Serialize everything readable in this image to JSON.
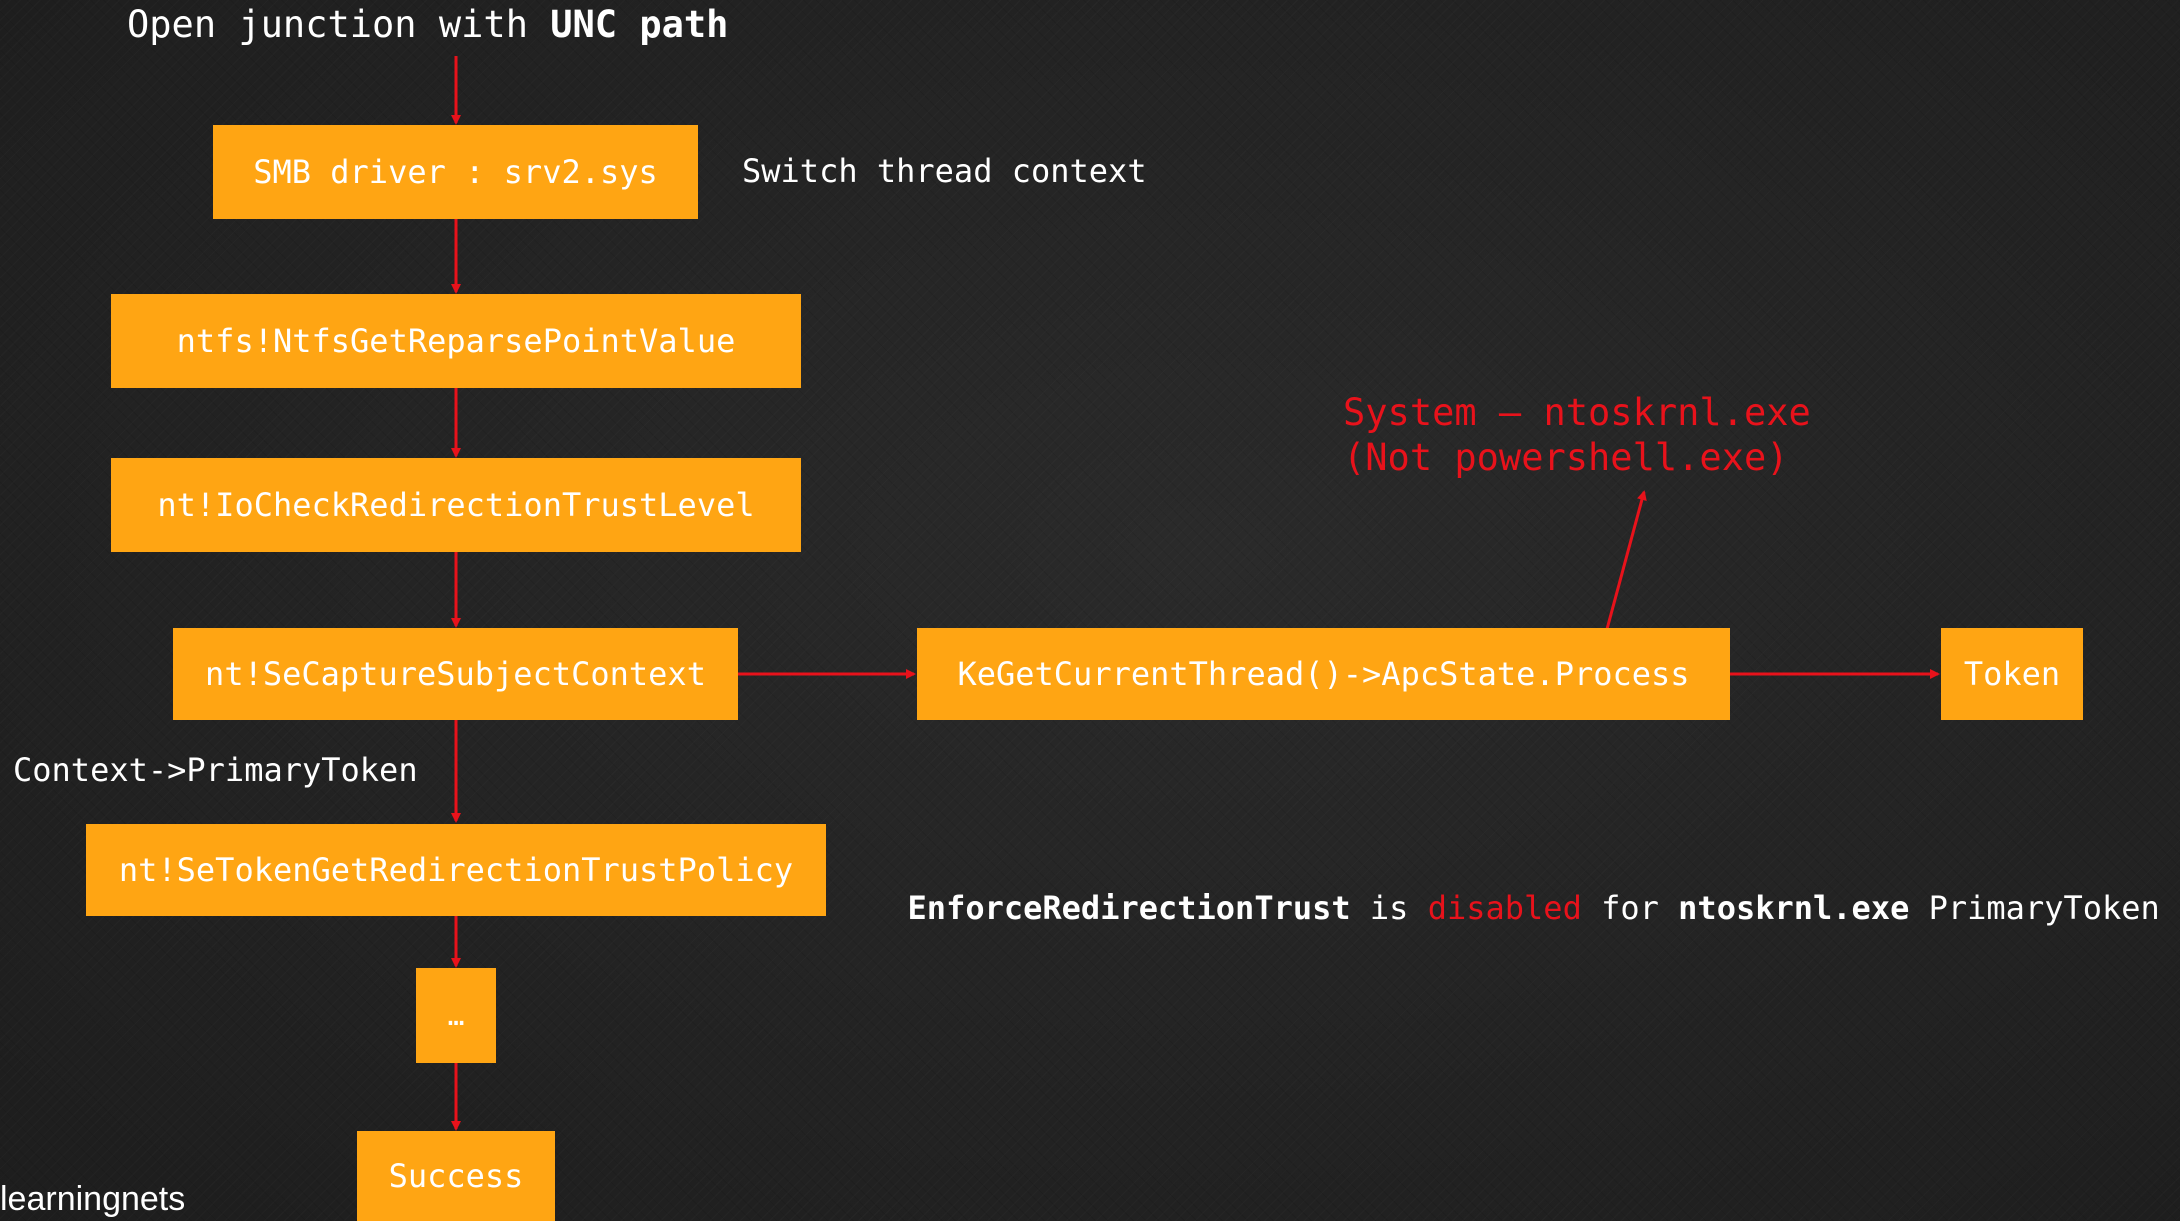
{
  "title": {
    "prefix": "Open junction with ",
    "bold": "UNC path"
  },
  "boxes": {
    "smb": "SMB driver : srv2.sys",
    "ntfs": "ntfs!NtfsGetReparsePointValue",
    "iocheck": "nt!IoCheckRedirectionTrustLevel",
    "secapture": "nt!SeCaptureSubjectContext",
    "kegetthread": "KeGetCurrentThread()->ApcState.Process",
    "token": "Token",
    "setoken": "nt!SeTokenGetRedirectionTrustPolicy",
    "ellipsis": "…",
    "success": "Success"
  },
  "labels": {
    "switch_context": "Switch thread context",
    "primary_token": "Context->PrimaryToken"
  },
  "annotation": {
    "line1": "System – ntoskrnl.exe",
    "line2": "(Not powershell.exe)"
  },
  "note": {
    "part1": "EnforceRedirectionTrust",
    "part2": " is ",
    "part3": "disabled",
    "part4": " for ",
    "part5": "ntoskrnl.exe",
    "part6": " PrimaryToken"
  },
  "watermark": "learningnets",
  "colors": {
    "box": "#ffa513",
    "arrow": "#e8121b",
    "background": "#222222"
  }
}
